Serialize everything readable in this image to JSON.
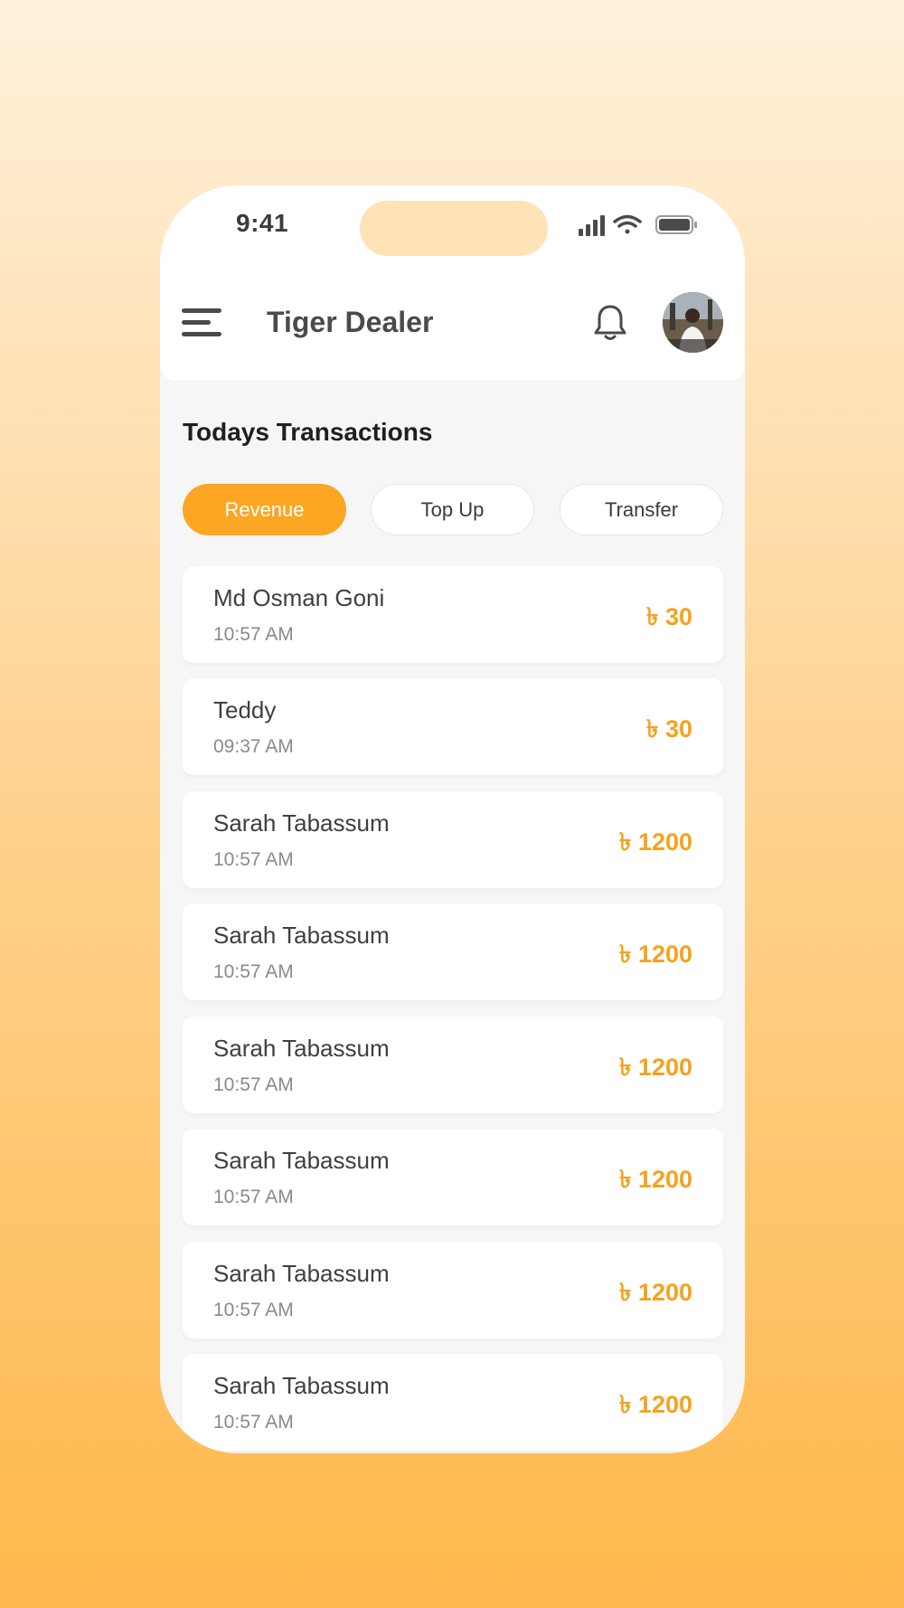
{
  "status_bar": {
    "time": "9:41"
  },
  "header": {
    "title": "Tiger Dealer"
  },
  "section": {
    "title": "Todays Transactions"
  },
  "tabs": [
    {
      "label": "Revenue",
      "active": true
    },
    {
      "label": "Top Up",
      "active": false
    },
    {
      "label": "Transfer",
      "active": false
    }
  ],
  "transactions": [
    {
      "name": "Md Osman Goni",
      "time": "10:57 AM",
      "amount": "৳ 30"
    },
    {
      "name": "Teddy",
      "time": "09:37 AM",
      "amount": "৳ 30"
    },
    {
      "name": "Sarah Tabassum",
      "time": "10:57 AM",
      "amount": "৳ 1200"
    },
    {
      "name": "Sarah Tabassum",
      "time": "10:57 AM",
      "amount": "৳ 1200"
    },
    {
      "name": "Sarah Tabassum",
      "time": "10:57 AM",
      "amount": "৳ 1200"
    },
    {
      "name": "Sarah Tabassum",
      "time": "10:57 AM",
      "amount": "৳ 1200"
    },
    {
      "name": "Sarah Tabassum",
      "time": "10:57 AM",
      "amount": "৳ 1200"
    },
    {
      "name": "Sarah Tabassum",
      "time": "10:57 AM",
      "amount": "৳ 1200"
    }
  ],
  "colors": {
    "accent": "#fca624",
    "amount": "#f5a21f",
    "background_top": "#fff1dc",
    "background_bottom": "#ffb84b"
  },
  "icons": [
    "signal-icon",
    "wifi-icon",
    "battery-icon",
    "menu-icon",
    "bell-icon"
  ]
}
